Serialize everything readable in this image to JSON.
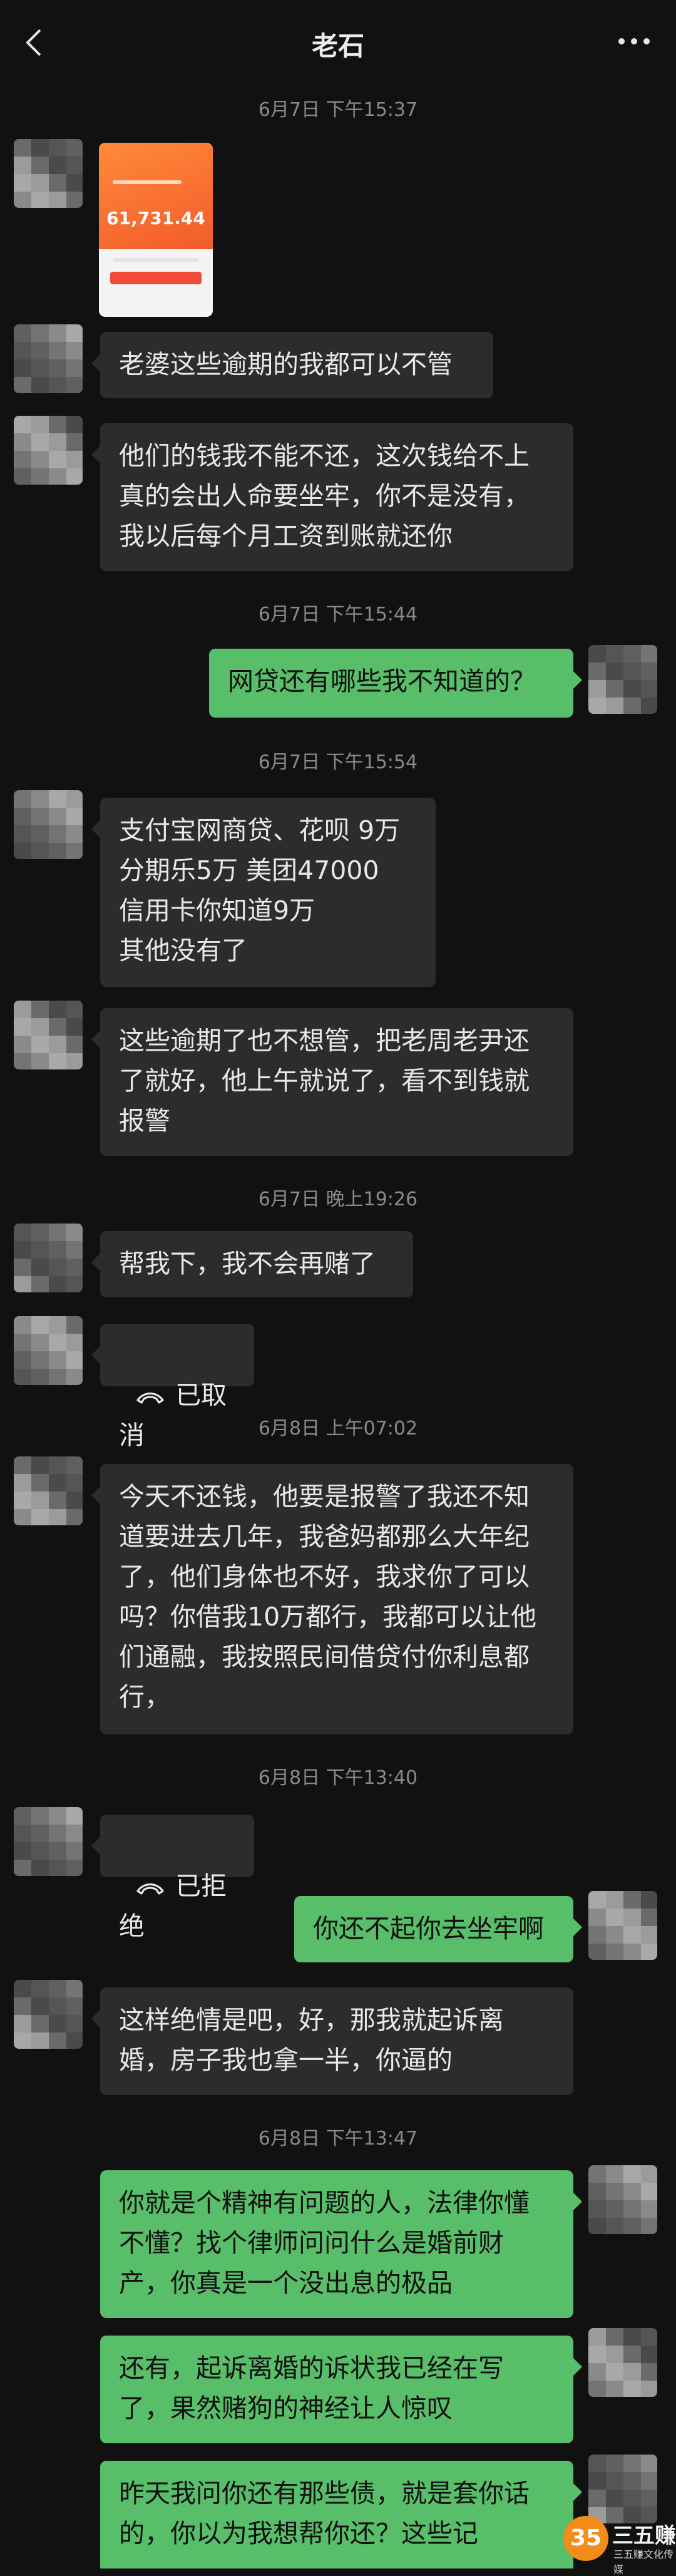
{
  "header": {
    "title": "老石"
  },
  "timestamps": [
    "6月7日 下午15:37",
    "6月7日 下午15:44",
    "6月7日 下午15:54",
    "6月7日 晚上19:26",
    "6月8日 上午07:02",
    "6月8日 下午13:40",
    "6月8日 下午13:47"
  ],
  "messages": {
    "m1_image_amount": "61,731.44",
    "m2": "老婆这些逾期的我都可以不管",
    "m3": "他们的钱我不能不还，这次钱给不上真的会出人命要坐牢，你不是没有，我以后每个月工资到账就还你",
    "m4": "网贷还有哪些我不知道的？",
    "m5": "支付宝网商贷、花呗 9万\n分期乐5万 美团47000\n信用卡你知道9万\n其他没有了",
    "m6": "这些逾期了也不想管，把老周老尹还了就好，他上午就说了，看不到钱就报警",
    "m7": "帮我下，我不会再赌了",
    "m8": "已取消",
    "m9": "今天不还钱，他要是报警了我还不知道要进去几年，我爸妈都那么大年纪了，他们身体也不好，我求你了可以吗？你借我10万都行，我都可以让他们通融，我按照民间借贷付你利息都行，",
    "m10": "已拒绝",
    "m11": "你还不起你去坐牢啊",
    "m12": "这样绝情是吧，好，那我就起诉离婚，房子我也拿一半，你逼的",
    "m13": "你就是个精神有问题的人，法律你懂不懂？找个律师问问什么是婚前财产，你真是一个没出息的极品",
    "m14": "还有，起诉离婚的诉状我已经在写了，果然赌狗的神经让人惊叹",
    "m15": "昨天我问你还有那些债，就是套你话的，你以为我想帮你还？这些记"
  },
  "watermark": {
    "badge": "35",
    "text": "三五赚",
    "sub": "三五赚文化传媒"
  },
  "colors": {
    "bg": "#111111",
    "left_bubble": "#2c2c2c",
    "right_bubble": "#58be6a",
    "timestamp": "#8a8a8a"
  }
}
